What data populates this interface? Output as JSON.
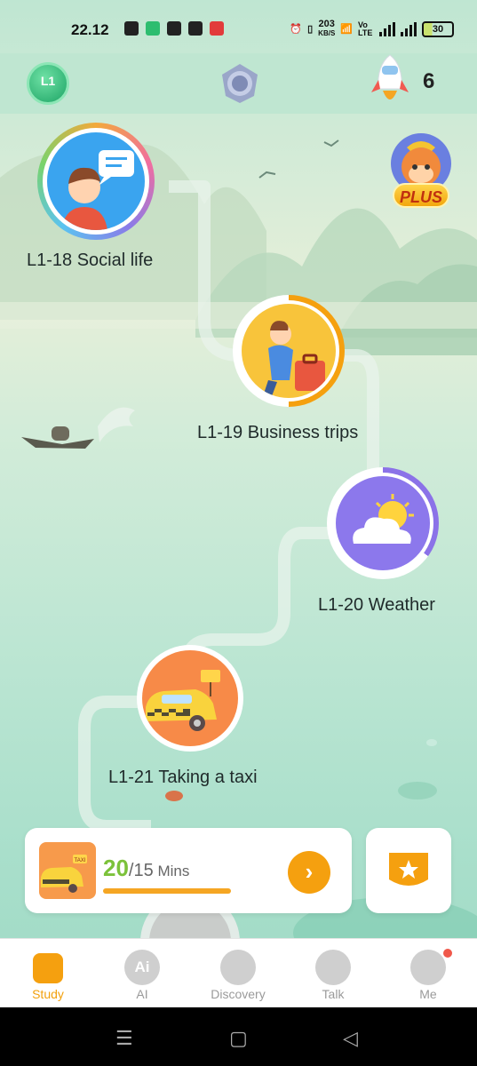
{
  "status_bar": {
    "time": "22.12",
    "net_speed_top": "203",
    "net_speed_unit": "KB/S",
    "volte": "Vo LTE",
    "battery": "30"
  },
  "header": {
    "level_badge": "L1",
    "energy_count": "6",
    "icons": [
      "level-shield-icon",
      "medal-icon",
      "rocket-icon"
    ]
  },
  "plus_badge": {
    "label": "PLUS"
  },
  "lessons": [
    {
      "label": "L1-18 Social life",
      "icon": "chat-person-icon",
      "progress": 1.0
    },
    {
      "label": "L1-19 Business trips",
      "icon": "traveler-icon",
      "progress": 0.5
    },
    {
      "label": "L1-20 Weather",
      "icon": "weather-cloud-icon",
      "progress": 0.35
    },
    {
      "label": "L1-21 Taking a taxi",
      "icon": "taxi-icon",
      "progress": 0.0
    }
  ],
  "progress_card": {
    "minutes_done": "20",
    "minutes_total": "/15",
    "unit": "Mins",
    "thumb_sign": "TAXI",
    "bar_fill": 1.0
  },
  "tabs": [
    {
      "label": "Study",
      "icon": "study-book-icon",
      "active": true
    },
    {
      "label": "AI",
      "icon_text": "Ai",
      "icon": "ai-icon",
      "active": false
    },
    {
      "label": "Discovery",
      "icon": "planet-icon",
      "active": false
    },
    {
      "label": "Talk",
      "icon": "talk-bubble-icon",
      "active": false
    },
    {
      "label": "Me",
      "icon": "smile-face-icon",
      "active": false
    }
  ],
  "colors": {
    "accent": "#f5a00f",
    "progress_green": "#7cc23a",
    "active_tab": "#f2a10e",
    "level_green": "#1da465"
  }
}
